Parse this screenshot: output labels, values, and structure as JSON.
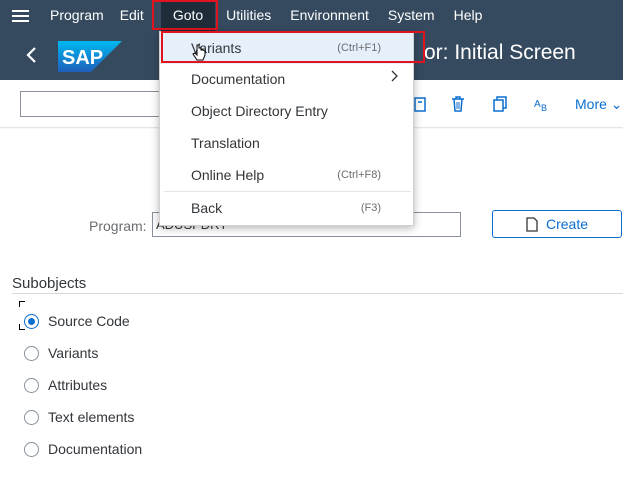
{
  "menubar": {
    "items": [
      "Program",
      "Edit",
      "Goto",
      "Utilities",
      "Environment",
      "System",
      "Help"
    ]
  },
  "titlebar": {
    "logo": "SAP",
    "title": "or: Initial Screen"
  },
  "toolbar": {
    "more_label": "More"
  },
  "form": {
    "program_label": "Program:",
    "program_value": "ADUSPDRT",
    "create_label": "Create"
  },
  "subobjects": {
    "title": "Subobjects",
    "options": [
      "Source Code",
      "Variants",
      "Attributes",
      "Text elements",
      "Documentation"
    ],
    "selected_index": 0
  },
  "goto_menu": {
    "items": [
      {
        "label": "Variants",
        "shortcut": "(Ctrl+F1)"
      },
      {
        "label": "Documentation",
        "shortcut": ""
      },
      {
        "label": "Object Directory Entry",
        "shortcut": ""
      },
      {
        "label": "Translation",
        "shortcut": ""
      },
      {
        "label": "Online Help",
        "shortcut": "(Ctrl+F8)"
      },
      {
        "label": "Back",
        "shortcut": "(F3)"
      }
    ]
  },
  "colors": {
    "shell": "#354a5f",
    "accent": "#0a6ed1",
    "highlight_red": "#e0131f"
  },
  "icons": [
    "hamburger-icon",
    "back-icon",
    "sap-logo",
    "save-icon",
    "delete-icon",
    "copy-icon",
    "rename-icon",
    "create-doc-icon",
    "chevron-right-icon",
    "mouse-cursor-icon"
  ]
}
